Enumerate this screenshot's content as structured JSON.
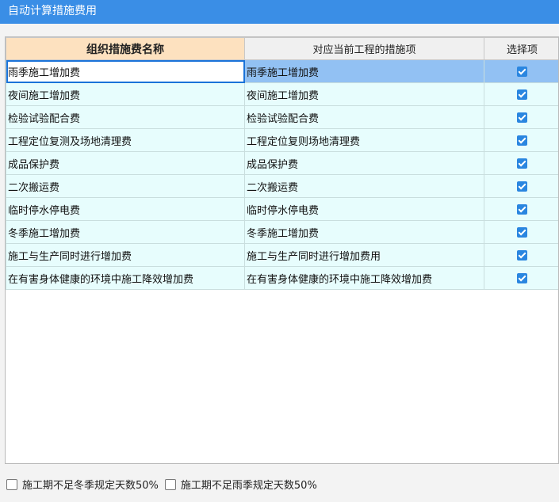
{
  "window": {
    "title": "自动计算措施费用"
  },
  "table": {
    "headers": [
      "组织措施费名称",
      "对应当前工程的措施项",
      "选择项"
    ],
    "rows": [
      {
        "name": "雨季施工增加费",
        "item": "雨季施工增加费",
        "checked": true
      },
      {
        "name": "夜间施工增加费",
        "item": "夜间施工增加费",
        "checked": true
      },
      {
        "name": "检验试验配合费",
        "item": "检验试验配合费",
        "checked": true
      },
      {
        "name": "工程定位复测及场地清理费",
        "item": "工程定位复则场地清理费",
        "checked": true
      },
      {
        "name": "成品保护费",
        "item": "成品保护费",
        "checked": true
      },
      {
        "name": "二次搬运费",
        "item": "二次搬运费",
        "checked": true
      },
      {
        "name": "临时停水停电费",
        "item": "临时停水停电费",
        "checked": true
      },
      {
        "name": "冬季施工增加费",
        "item": "冬季施工增加费",
        "checked": true
      },
      {
        "name": "施工与生产同时进行增加费",
        "item": "施工与生产同时进行增加费用",
        "checked": true
      },
      {
        "name": "在有害身体健康的环境中施工降效增加费",
        "item": "在有害身体健康的环境中施工降效增加费",
        "checked": true
      }
    ]
  },
  "footer": {
    "option1": {
      "label": "施工期不足冬季规定天数50%",
      "checked": false
    },
    "option2": {
      "label": "施工期不足雨季规定天数50%",
      "checked": false
    }
  },
  "colors": {
    "titlebar": "#3a8ee6",
    "check": "#2a86e0",
    "row": "#e7fdfd",
    "selected": "#92c1f3",
    "header": "#fde1bf"
  }
}
